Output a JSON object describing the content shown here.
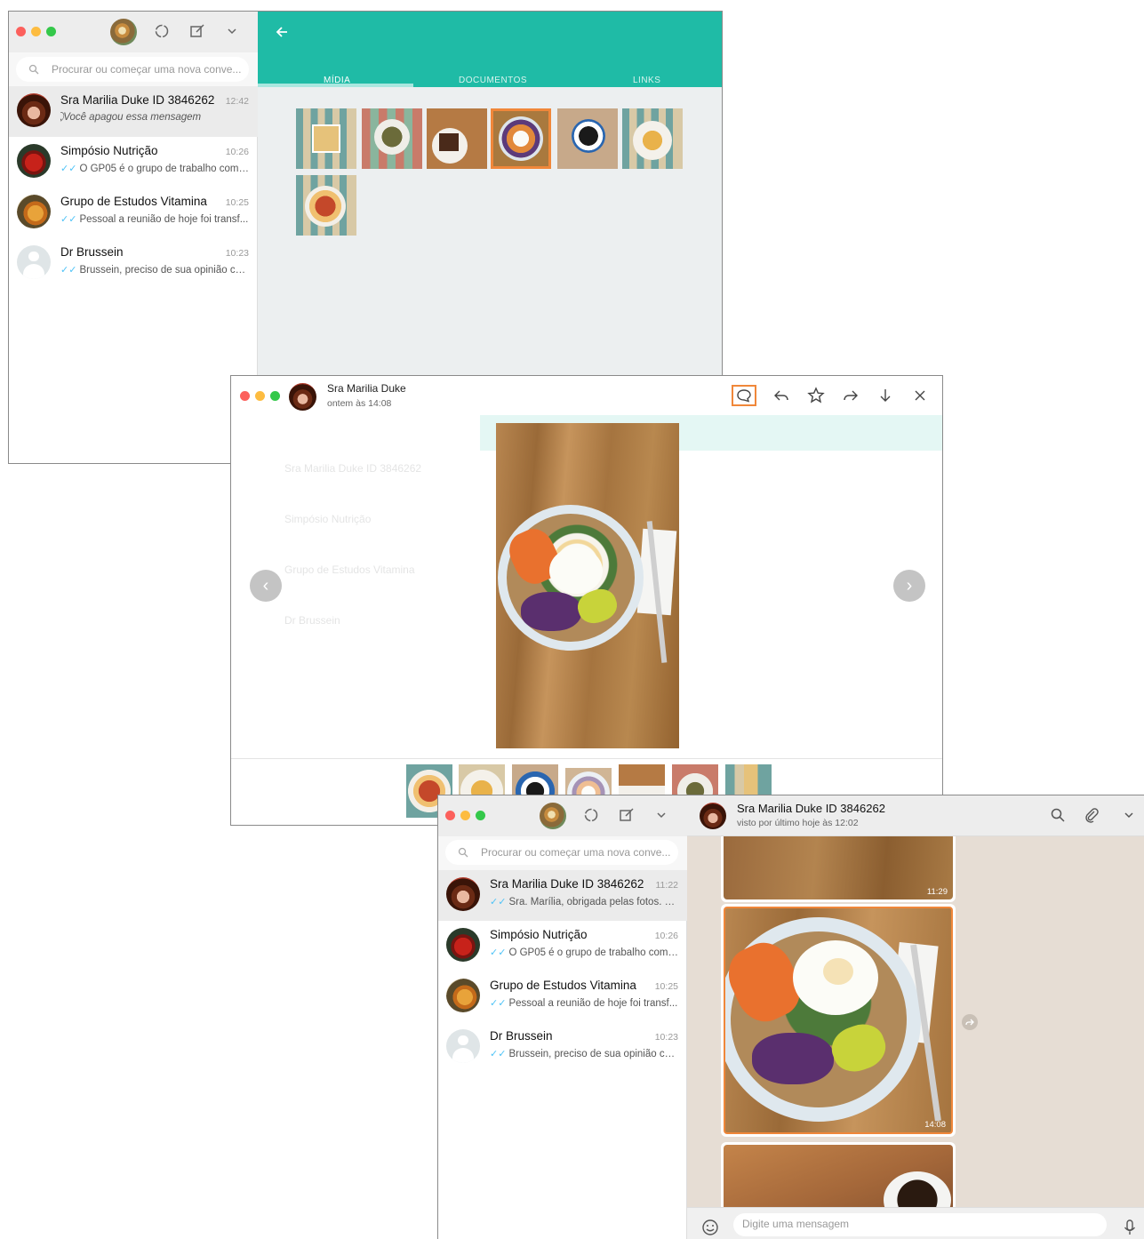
{
  "win1": {
    "search_placeholder": "Procurar ou começar uma nova conve...",
    "chats": [
      {
        "name": "Sra Marilia Duke ID 3846262",
        "time": "12:42",
        "preview": "Você apagou essa mensagem"
      },
      {
        "name": "Simpósio Nutrição",
        "time": "10:26",
        "preview": "O GP05 é o grupo de trabalho com ..."
      },
      {
        "name": "Grupo de Estudos Vitamina",
        "time": "10:25",
        "preview": "Pessoal a reunião de hoje foi transf..."
      },
      {
        "name": "Dr Brussein",
        "time": "10:23",
        "preview": "Brussein, preciso de sua opinião co..."
      }
    ],
    "tabs": {
      "media": "MÍDIA",
      "docs": "DOCUMENTOS",
      "links": "LINKS"
    }
  },
  "win2": {
    "contact_name": "Sra Marilia Duke",
    "subtitle": "ontem às 14:08",
    "ghost": {
      "c1": "Sra Marilia Duke ID 3846262",
      "c2": "Simpósio Nutrição",
      "c3": "Grupo de Estudos Vitamina",
      "c4": "Dr Brussein"
    }
  },
  "win3": {
    "search_placeholder": "Procurar ou começar uma nova conve...",
    "chats": [
      {
        "name": "Sra Marilia Duke ID 3846262",
        "time": "11:22",
        "preview": "Sra. Marília, obrigada pelas fotos. E..."
      },
      {
        "name": "Simpósio Nutrição",
        "time": "10:26",
        "preview": "O GP05 é o grupo de trabalho com ..."
      },
      {
        "name": "Grupo de Estudos Vitamina",
        "time": "10:25",
        "preview": "Pessoal a reunião de hoje foi transf..."
      },
      {
        "name": "Dr Brussein",
        "time": "10:23",
        "preview": "Brussein, preciso de sua opinião co..."
      }
    ],
    "header_name": "Sra Marilia Duke ID 3846262",
    "header_status": "visto por último hoje às 12:02",
    "msg_times": {
      "m1": "11:29",
      "m2": "14:08"
    },
    "composer_placeholder": "Digite uma mensagem"
  },
  "colors": {
    "teal": "#1fbba6",
    "highlight": "#f0873a",
    "selected_row": "#ebebeb",
    "chat_bg": "#e6ddd4"
  }
}
